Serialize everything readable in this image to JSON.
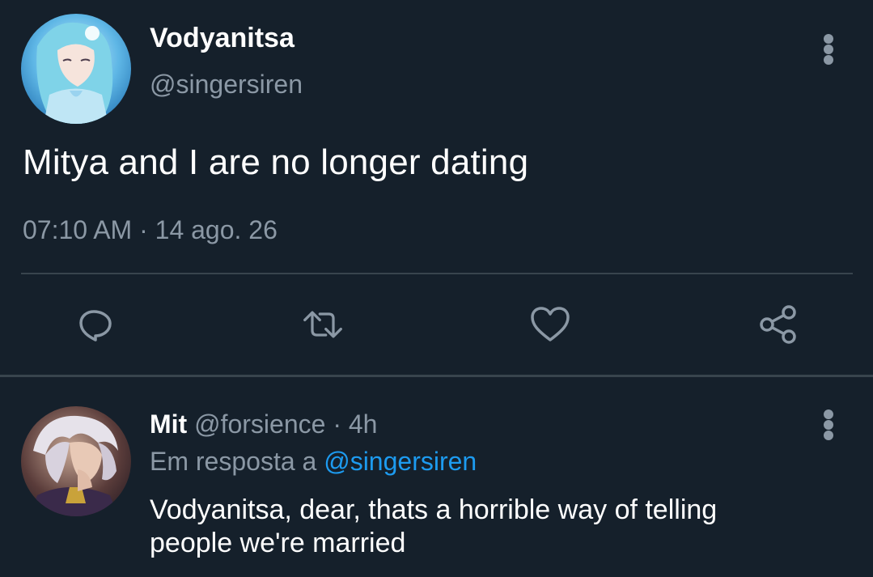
{
  "main_tweet": {
    "display_name": "Vodyanitsa",
    "handle": "@singersiren",
    "text": "Mitya and I are no longer dating",
    "timestamp": "07:10 AM · 14 ago. 26",
    "avatar_icon": "anime-avatar-blue-hair",
    "actions": [
      {
        "name": "reply",
        "icon": "reply-bubble-icon"
      },
      {
        "name": "retweet",
        "icon": "retweet-icon"
      },
      {
        "name": "like",
        "icon": "heart-icon"
      },
      {
        "name": "share",
        "icon": "share-icon"
      }
    ]
  },
  "reply_tweet": {
    "display_name": "Mit",
    "handle": "@forsience",
    "separator": " · ",
    "time": "4h",
    "reply_prefix": "Em resposta a ",
    "reply_to": "@singersiren",
    "line1": "Vodyanitsa, dear, thats a horrible way of telling",
    "line2": "people we're married",
    "avatar_icon": "anime-avatar-silver-hair"
  },
  "colors": {
    "background": "#15202b",
    "text_primary": "#ffffff",
    "text_secondary": "#8b98a5",
    "divider": "#38444d",
    "link": "#1d9bf0"
  }
}
